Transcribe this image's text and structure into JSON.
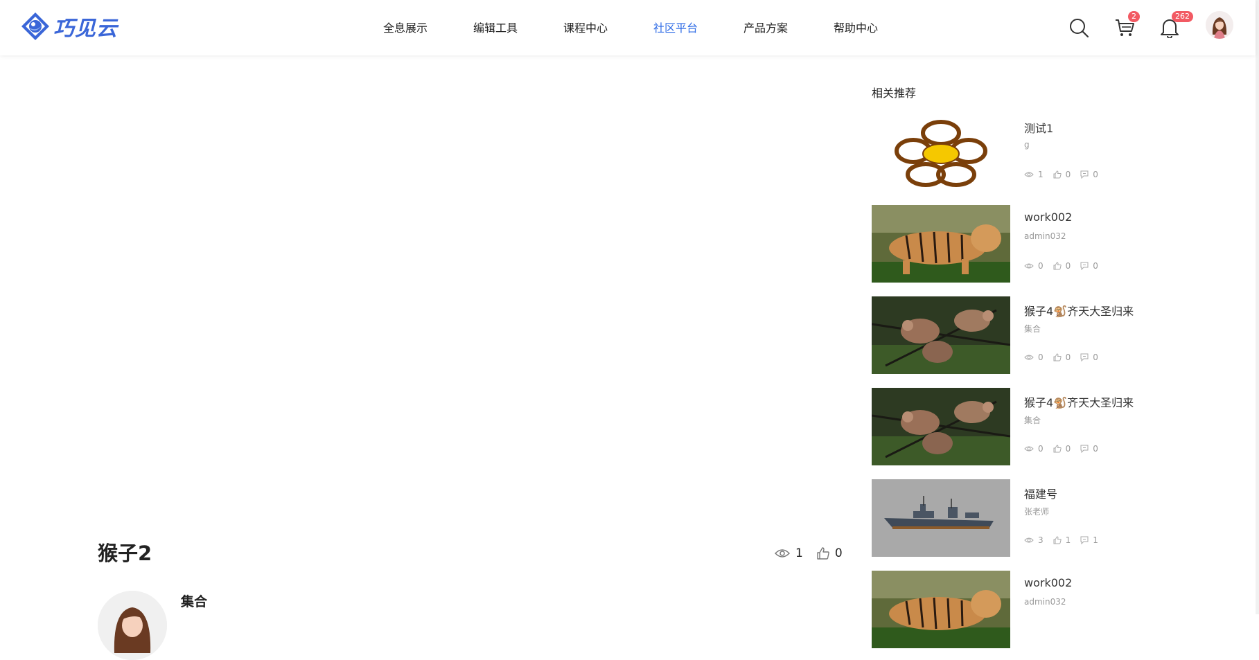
{
  "brand": {
    "name": "巧见云",
    "color": "#3a66d8"
  },
  "nav": {
    "items": [
      {
        "label": "全息展示"
      },
      {
        "label": "编辑工具"
      },
      {
        "label": "课程中心"
      },
      {
        "label": "社区平台"
      },
      {
        "label": "产品方案"
      },
      {
        "label": "帮助中心"
      }
    ],
    "active": "社区平台",
    "active_color": "#2e6be6"
  },
  "header_icons": {
    "search": "search-icon",
    "cart": {
      "icon": "cart-icon",
      "badge": "2"
    },
    "notifications": {
      "icon": "bell-icon",
      "badge": "262"
    }
  },
  "work": {
    "title": "猴子2",
    "views": "1",
    "likes": "0",
    "author": "集合"
  },
  "recommend": {
    "title": "相关推荐",
    "items": [
      {
        "name": "测试1",
        "author": "g",
        "views": "1",
        "likes": "0",
        "comments": "0",
        "thumb": "flower"
      },
      {
        "name": "work002",
        "author": "admin032",
        "views": "0",
        "likes": "0",
        "comments": "0",
        "thumb": "tiger"
      },
      {
        "name": "猴子4🐒齐天大圣归来",
        "author": "集合",
        "views": "0",
        "likes": "0",
        "comments": "0",
        "thumb": "monkeys"
      },
      {
        "name": "猴子4🐒齐天大圣归来",
        "author": "集合",
        "views": "0",
        "likes": "0",
        "comments": "0",
        "thumb": "monkeys"
      },
      {
        "name": "福建号",
        "author": "张老师",
        "views": "3",
        "likes": "1",
        "comments": "1",
        "thumb": "ship"
      },
      {
        "name": "work002",
        "author": "admin032",
        "views": "",
        "likes": "",
        "comments": "",
        "thumb": "tiger"
      }
    ]
  }
}
